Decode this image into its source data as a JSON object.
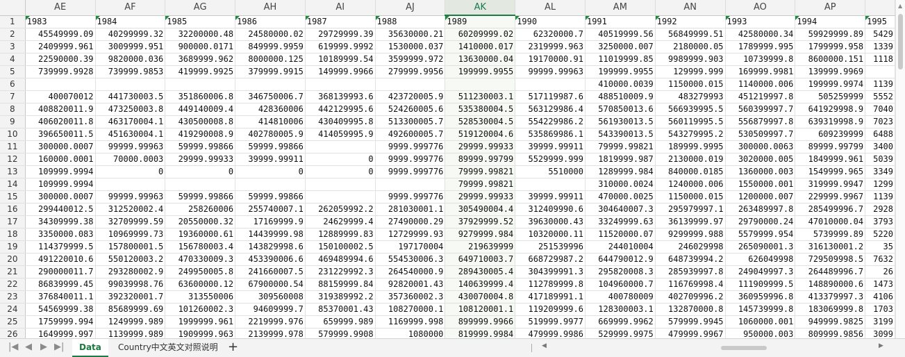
{
  "columns": [
    "AE",
    "AF",
    "AG",
    "AH",
    "AI",
    "AJ",
    "AK",
    "AL",
    "AM",
    "AN",
    "AO",
    "AP",
    ""
  ],
  "selected_column": "AK",
  "rows": [
    {
      "n": "1",
      "cells": [
        "1983",
        "1984",
        "1985",
        "1986",
        "1987",
        "1988",
        "1989",
        "1990",
        "1991",
        "1992",
        "1993",
        "1994",
        "1995"
      ]
    },
    {
      "n": "2",
      "cells": [
        "45549999.09",
        "40299999.32",
        "32200000.48",
        "24580000.02",
        "29729999.39",
        "35630000.21",
        "60209999.02",
        "62320000.7",
        "40519999.56",
        "56849999.51",
        "42580000.34",
        "59929999.89",
        "5429"
      ]
    },
    {
      "n": "3",
      "cells": [
        "2409999.961",
        "3009999.951",
        "900000.0171",
        "849999.9959",
        "619999.9992",
        "1530000.037",
        "1410000.017",
        "2319999.963",
        "3250000.007",
        "2180000.05",
        "1789999.995",
        "1799999.958",
        "1339"
      ]
    },
    {
      "n": "4",
      "cells": [
        "22590000.39",
        "9820000.036",
        "3689999.962",
        "8000000.125",
        "10189999.54",
        "3599999.972",
        "13630000.04",
        "19170000.91",
        "11019999.85",
        "9989999.903",
        "10739999.8",
        "8600000.151",
        "1118"
      ]
    },
    {
      "n": "5",
      "cells": [
        "739999.9928",
        "739999.9853",
        "419999.9925",
        "379999.9915",
        "149999.9966",
        "279999.9956",
        "199999.9955",
        "99999.99963",
        "199999.9955",
        "129999.999",
        "169999.9981",
        "139999.9969",
        ""
      ]
    },
    {
      "n": "6",
      "cells": [
        "",
        "",
        "",
        "",
        "",
        "",
        "",
        "",
        "410000.0039",
        "1150000.015",
        "1140000.006",
        "199999.9974",
        "1139"
      ]
    },
    {
      "n": "7",
      "cells": [
        "400070012",
        "441730003.5",
        "351860006.8",
        "346750006.7",
        "368139993.6",
        "423720005.9",
        "511230003.1",
        "517119987.6",
        "488510009.9",
        "483279993",
        "451219997.8",
        "505259999",
        "5552"
      ]
    },
    {
      "n": "8",
      "cells": [
        "408820011.9",
        "473250003.8",
        "449140009.4",
        "428360006",
        "442129995.6",
        "524260005.6",
        "535380004.5",
        "563129986.4",
        "570850013.6",
        "566939995.5",
        "560399997.7",
        "641929998.9",
        "7040"
      ]
    },
    {
      "n": "9",
      "cells": [
        "406020011.8",
        "463170004.1",
        "430500008.8",
        "414810006",
        "430409995.8",
        "513300005.7",
        "528530004.5",
        "554229986.2",
        "561930013.5",
        "560119995.5",
        "556879997.8",
        "639319998.9",
        "7023"
      ]
    },
    {
      "n": "10",
      "cells": [
        "396650011.5",
        "451630004.1",
        "419290008.9",
        "402780005.9",
        "414059995.9",
        "492600005.7",
        "519120004.6",
        "535869986.1",
        "543390013.5",
        "543279995.2",
        "530509997.7",
        "609239999",
        "6488"
      ]
    },
    {
      "n": "11",
      "cells": [
        "300000.0007",
        "99999.99963",
        "59999.99866",
        "59999.99866",
        "",
        "9999.999776",
        "29999.99933",
        "39999.99911",
        "79999.99821",
        "189999.9995",
        "300000.0063",
        "89999.99799",
        "3400"
      ]
    },
    {
      "n": "12",
      "cells": [
        "160000.0001",
        "70000.0003",
        "29999.99933",
        "39999.99911",
        "0",
        "9999.999776",
        "89999.99799",
        "5529999.999",
        "1819999.987",
        "2130000.019",
        "3020000.005",
        "1849999.961",
        "5039"
      ]
    },
    {
      "n": "13",
      "cells": [
        "109999.9994",
        "0",
        "0",
        "0",
        "0",
        "9999.999776",
        "79999.99821",
        "5510000",
        "1289999.984",
        "840000.0185",
        "1360000.003",
        "1549999.965",
        "3349"
      ]
    },
    {
      "n": "14",
      "cells": [
        "109999.9994",
        "",
        "",
        "",
        "",
        "",
        "79999.99821",
        "",
        "310000.0024",
        "1240000.006",
        "1550000.001",
        "319999.9947",
        "1299"
      ]
    },
    {
      "n": "15",
      "cells": [
        "300000.0007",
        "99999.99963",
        "59999.99866",
        "59999.99866",
        "",
        "9999.999776",
        "29999.99933",
        "39999.99911",
        "470000.0025",
        "1150000.015",
        "1200000.007",
        "229999.9967",
        "1139"
      ]
    },
    {
      "n": "16",
      "cells": [
        "299440012.5",
        "312520002.4",
        "258260006",
        "255740007.1",
        "262059992.2",
        "281030001.1",
        "305490004.4",
        "312409990.6",
        "304640007.3",
        "295979997.1",
        "263489997.8",
        "285499996.7",
        "2928"
      ]
    },
    {
      "n": "17",
      "cells": [
        "34309999.38",
        "32709999.59",
        "20550000.32",
        "17169999.9",
        "24629999.4",
        "27490000.29",
        "37929999.52",
        "39630000.43",
        "33249999.63",
        "36139999.97",
        "29790000.24",
        "47010000.04",
        "3793"
      ]
    },
    {
      "n": "18",
      "cells": [
        "3350000.083",
        "10969999.73",
        "19360000.61",
        "14439999.98",
        "12889999.83",
        "12729999.93",
        "9279999.984",
        "10320000.11",
        "11520000.07",
        "9299999.988",
        "5579999.954",
        "5739999.89",
        "5220"
      ]
    },
    {
      "n": "19",
      "cells": [
        "114379999.5",
        "157800001.5",
        "156780003.4",
        "143829998.6",
        "150100002.5",
        "197170004",
        "219639999",
        "251539996",
        "244010004",
        "246029998",
        "265090001.3",
        "316130001.2",
        "35"
      ]
    },
    {
      "n": "20",
      "cells": [
        "491220010.6",
        "550120003.2",
        "470330009.3",
        "453390006.6",
        "469489994.6",
        "554530006.3",
        "649710003.7",
        "668729987.2",
        "644790012.9",
        "648739994.2",
        "626049998",
        "729509998.5",
        "7632"
      ]
    },
    {
      "n": "21",
      "cells": [
        "290000011.7",
        "293280002.9",
        "249950005.8",
        "241660007.5",
        "231229992.3",
        "264540000.9",
        "289430005.4",
        "304399991.3",
        "295820008.3",
        "285939997.8",
        "249049997.3",
        "264489996.7",
        "26"
      ]
    },
    {
      "n": "22",
      "cells": [
        "86839999.45",
        "99039998.76",
        "63600000.12",
        "67900000.54",
        "88159999.84",
        "92820001.43",
        "140639999.4",
        "112789999.8",
        "104960000.7",
        "116769998.4",
        "111909999.5",
        "148890000.6",
        "1473"
      ]
    },
    {
      "n": "23",
      "cells": [
        "376840011.1",
        "392320001.7",
        "313550006",
        "309560008",
        "319389992.2",
        "357360002.3",
        "430070004.8",
        "417189991.1",
        "400780009",
        "402709996.2",
        "360959996.8",
        "413379997.3",
        "4106"
      ]
    },
    {
      "n": "24",
      "cells": [
        "54569999.38",
        "85689999.69",
        "101260002.3",
        "94609999.7",
        "85370001.43",
        "108270000.1",
        "108120001.1",
        "119209999.6",
        "128300003.1",
        "132870000.8",
        "145739999.8",
        "183069999.8",
        "1703"
      ]
    },
    {
      "n": "25",
      "cells": [
        "1759999.994",
        "1249999.989",
        "1999999.961",
        "2219999.976",
        "659999.989",
        "1169999.998",
        "899999.9966",
        "519999.9977",
        "669999.9962",
        "579999.9945",
        "1060000.001",
        "949999.9825",
        "3199"
      ]
    },
    {
      "n": "26",
      "cells": [
        "1649999.997",
        "1139999.989",
        "1909999.963",
        "2139999.978",
        "579999.9908",
        "1080000",
        "819999.9984",
        "479999.9986",
        "529999.9975",
        "479999.9967",
        "950000.003",
        "809999.9856",
        "3099"
      ]
    }
  ],
  "tabs": {
    "nav_first": "|◀",
    "nav_prev": "◀",
    "nav_next": "▶",
    "nav_last": "▶|",
    "sheet1": "Data",
    "sheet2": "Country中文英文对照说明",
    "add": "+"
  },
  "colors": {
    "accent": "#1e7a46",
    "header_bg": "#f3f3f3",
    "grid_line": "#e1e1e1"
  }
}
